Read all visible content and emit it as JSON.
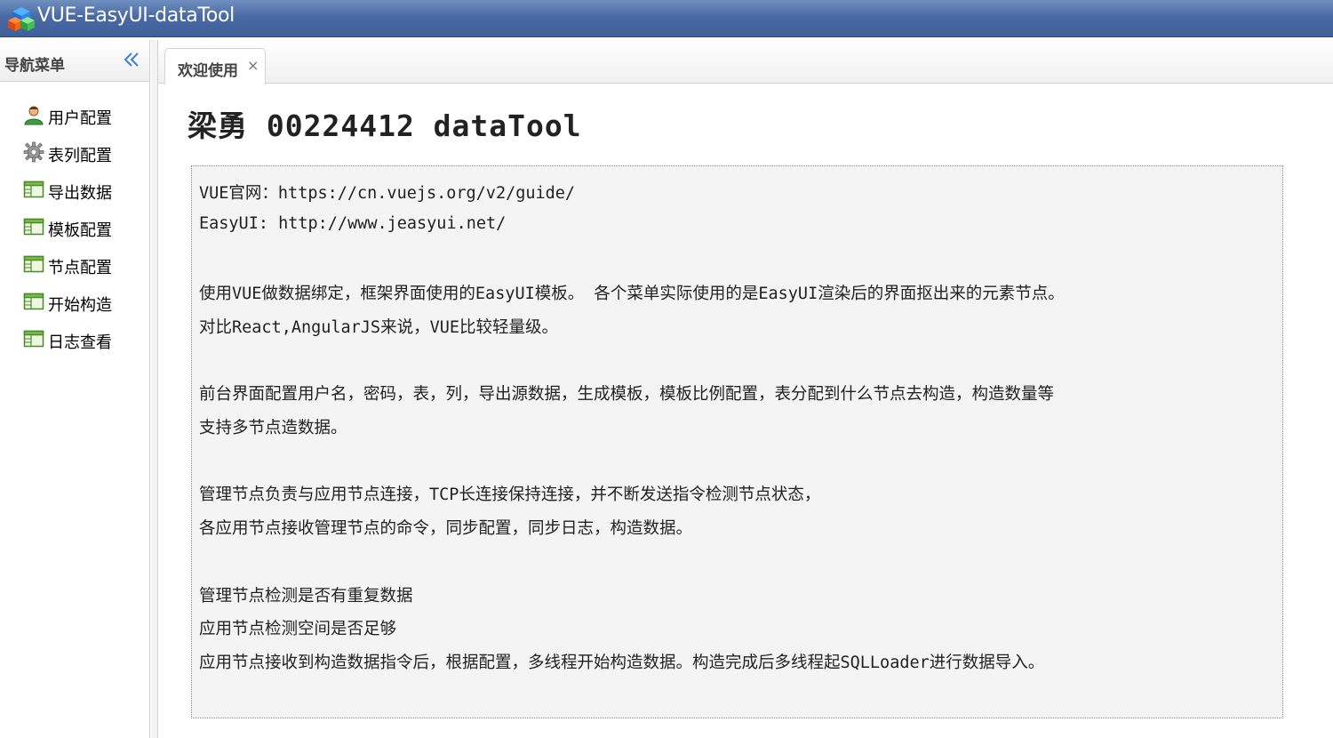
{
  "window": {
    "title": "VUE-EasyUI-dataTool",
    "logo_icon": "cubes-logo-icon"
  },
  "west": {
    "title": "导航菜单",
    "collapse_icon": "double-chevron-left-icon",
    "items": [
      {
        "label": "用户配置",
        "icon": "user-icon"
      },
      {
        "label": "表列配置",
        "icon": "gear-icon"
      },
      {
        "label": "导出数据",
        "icon": "table-icon"
      },
      {
        "label": "模板配置",
        "icon": "table-icon"
      },
      {
        "label": "节点配置",
        "icon": "table-icon"
      },
      {
        "label": "开始构造",
        "icon": "table-icon"
      },
      {
        "label": "日志查看",
        "icon": "table-icon"
      }
    ]
  },
  "tabs": [
    {
      "label": "欢迎使用",
      "close": "×"
    }
  ],
  "content": {
    "heading": "梁勇 00224412 dataTool",
    "lines": [
      "VUE官网：https://cn.vuejs.org/v2/guide/",
      "EasyUI: http://www.jeasyui.net/",
      "使用VUE做数据绑定，框架界面使用的EasyUI模板。 各个菜单实际使用的是EasyUI渲染后的界面抠出来的元素节点。",
      "对比React,AngularJS来说，VUE比较轻量级。",
      "前台界面配置用户名，密码，表，列，导出源数据，生成模板，模板比例配置，表分配到什么节点去构造，构造数量等",
      "支持多节点造数据。",
      "管理节点负责与应用节点连接，TCP长连接保持连接，并不断发送指令检测节点状态，",
      "各应用节点接收管理节点的命令，同步配置，同步日志，构造数据。",
      "管理节点检测是否有重复数据",
      "应用节点检测空间是否足够",
      "应用节点接收到构造数据指令后，根据配置，多线程开始构造数据。构造完成后多线程起SQLLoader进行数据导入。"
    ]
  },
  "colors": {
    "titlebar": "#4a6aa4",
    "content_box": "#f4f4f4",
    "tab_border": "#d3d3d3"
  }
}
